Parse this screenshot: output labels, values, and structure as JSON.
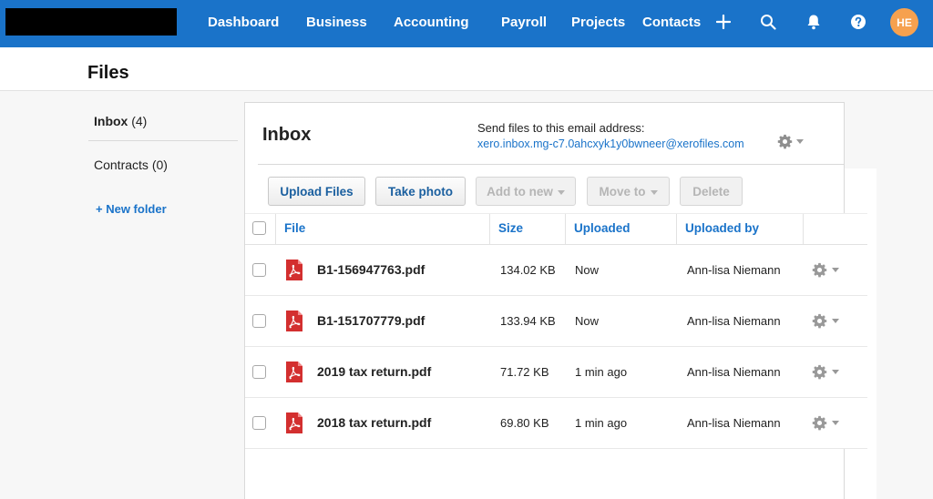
{
  "nav": {
    "items": [
      {
        "label": "Dashboard"
      },
      {
        "label": "Business"
      },
      {
        "label": "Accounting"
      },
      {
        "label": "Payroll"
      },
      {
        "label": "Projects"
      },
      {
        "label": "Contacts"
      }
    ],
    "avatar_initials": "HE"
  },
  "page": {
    "title": "Files"
  },
  "sidebar": {
    "items": [
      {
        "name": "Inbox",
        "count": "(4)"
      },
      {
        "name": "Contracts",
        "count": "(0)"
      }
    ],
    "new_folder": "+ New folder"
  },
  "inbox": {
    "title": "Inbox",
    "send_label": "Send files to this email address:",
    "email": "xero.inbox.mg-c7.0ahcxyk1y0bwneer@xerofiles.com"
  },
  "toolbar": {
    "upload": "Upload Files",
    "take_photo": "Take photo",
    "add_to_new": "Add to new",
    "move_to": "Move to",
    "delete": "Delete"
  },
  "table": {
    "headers": {
      "file": "File",
      "size": "Size",
      "uploaded": "Uploaded",
      "uploaded_by": "Uploaded by"
    },
    "rows": [
      {
        "file": "B1-156947763.pdf",
        "size": "134.02 KB",
        "uploaded": "Now",
        "by": "Ann-lisa Niemann"
      },
      {
        "file": "B1-151707779.pdf",
        "size": "133.94 KB",
        "uploaded": "Now",
        "by": "Ann-lisa Niemann"
      },
      {
        "file": "2019 tax return.pdf",
        "size": "71.72 KB",
        "uploaded": "1 min ago",
        "by": "Ann-lisa Niemann"
      },
      {
        "file": "2018 tax return.pdf",
        "size": "69.80 KB",
        "uploaded": "1 min ago",
        "by": "Ann-lisa Niemann"
      }
    ]
  },
  "colors": {
    "brand": "#1a73c9",
    "avatar": "#f6a14f",
    "pdf": "#d32f2f"
  }
}
